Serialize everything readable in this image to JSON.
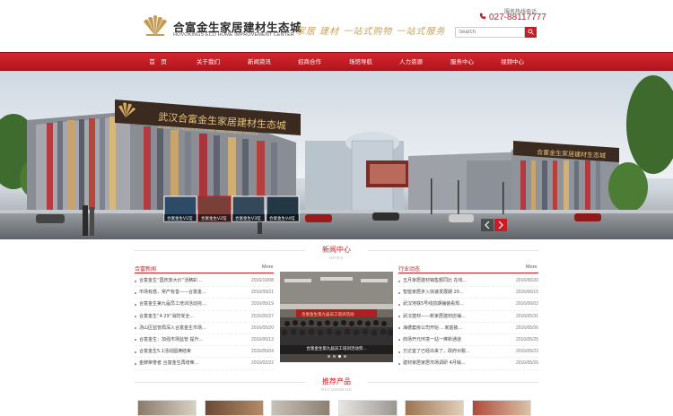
{
  "header": {
    "logo_cn": "合富金生家居建材生态城",
    "logo_en": "HOVOKINGS ECO HOME IMPROVEMENT CENTER",
    "slogan": "家居 建材 一站式购物 一站式服务",
    "hotline_label": "服务热线电话",
    "hotline": "027-88117777",
    "search_placeholder": "Search"
  },
  "nav": {
    "items": [
      "首　页",
      "关于我们",
      "新闻资讯",
      "招商合作",
      "场馆导航",
      "人力资源",
      "服务中心",
      "视频中心"
    ]
  },
  "banner": {
    "sign_cn": "武汉合富金生家居建材生态城",
    "sign_en": "WUHAN HOVOKINGS ECO HOME IMPROVEMENT CENTER",
    "sign_right": "合富金生家居建材生态城",
    "thumbs": [
      "合富金生V1馆",
      "合富金生V2馆",
      "合富金生V3馆",
      "合富金生V4馆"
    ]
  },
  "news_section": {
    "title": "新闻中心",
    "subtitle": "NEWS"
  },
  "company_news": {
    "heading": "合富新闻",
    "more": "More",
    "items": [
      {
        "title": "合富金生“国庆放大价”活精彩...",
        "date": "2016/10/08"
      },
      {
        "title": "市场有惑，常产有善——合富金...",
        "date": "2016/09/21"
      },
      {
        "title": "合富金生第九届员工培训活动完...",
        "date": "2016/05/19"
      },
      {
        "title": "合富金生“4·29”消防安全...",
        "date": "2016/05/27"
      },
      {
        "title": "汤山区监管局深入合富金生市场...",
        "date": "2016/05/20"
      },
      {
        "title": "合富金生：加强市场监管 提升...",
        "date": "2016/05/13"
      },
      {
        "title": "合富金生5.1活动圆满结束",
        "date": "2016/05/04"
      },
      {
        "title": "金牌荣誉者 合富金生再增荣...",
        "date": "2016/02/22"
      }
    ]
  },
  "photo": {
    "caption": "合富金生第九届员工培训活动完..."
  },
  "industry_news": {
    "heading": "行业动态",
    "more": "More",
    "items": [
      {
        "title": "五月家居建材销售额同比 在线...",
        "date": "2016/06/20"
      },
      {
        "title": "智能家居步入快速发展期 20...",
        "date": "2016/06/15"
      },
      {
        "title": "武汉地铁5号线前期铺装看规...",
        "date": "2016/06/02"
      },
      {
        "title": "武汉建材——新家居建材店铺...",
        "date": "2016/05/31"
      },
      {
        "title": "海德套房公司开始 ...家庭装...",
        "date": "2016/05/26"
      },
      {
        "title": "商场开元环境一站一棒新通道",
        "date": "2016/05/25"
      },
      {
        "title": "万达室了已经出来了，政府对税...",
        "date": "2016/05/23"
      },
      {
        "title": "建材家居家居市场调研 4月销...",
        "date": "2016/05/26"
      }
    ]
  },
  "products_section": {
    "title": "推荐产品",
    "subtitle": "RECOMMEND"
  },
  "colors": {
    "brand_red": "#c81d25",
    "gold": "#c7a15a"
  }
}
